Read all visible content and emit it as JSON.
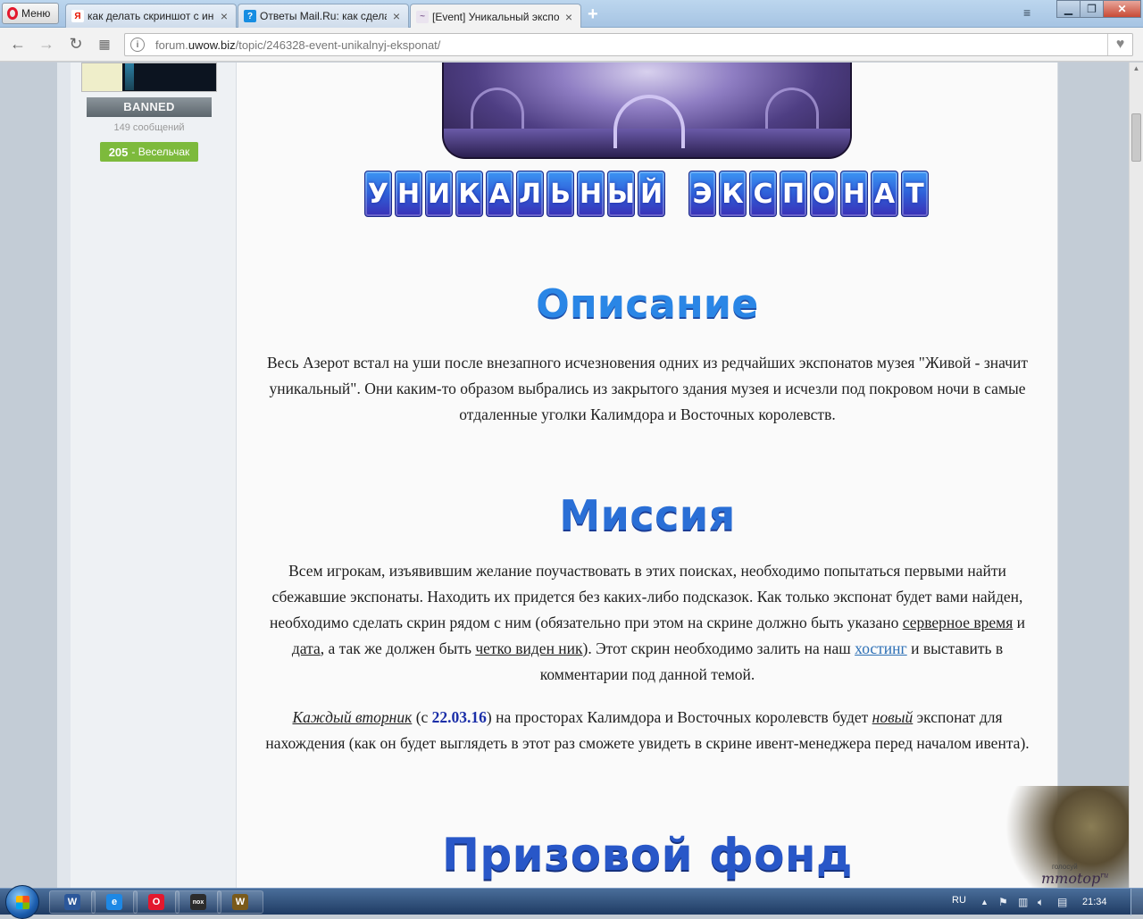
{
  "browser": {
    "menu_label": "Меню",
    "tabs": [
      {
        "title": "как делать скриншот с ин",
        "fav": "Я",
        "fav_color": "#e61400",
        "fav_bg": "#ffffff"
      },
      {
        "title": "Ответы Mail.Ru: как сдела",
        "fav": "?",
        "fav_color": "#ffffff",
        "fav_bg": "#168de2"
      },
      {
        "title": "[Event] Уникальный экспо",
        "fav": "~",
        "fav_color": "#8a6a9a",
        "fav_bg": "#eae4ef"
      }
    ],
    "url_domain": "forum.uwow.biz",
    "url_path": "/topic/246328-event-unikalnyj-eksponat/",
    "url_prefix": "forum."
  },
  "sidebar": {
    "banned_label": "BANNED",
    "posts_count": "149 сообщений",
    "rep_value": "205",
    "rep_label": "- Весельчак",
    "rep_color": "#7dba3c"
  },
  "post": {
    "banner_title": [
      "У",
      "Н",
      "И",
      "К",
      "А",
      "Л",
      "Ь",
      "Н",
      "Ы",
      "Й",
      " ",
      "Э",
      "К",
      "С",
      "П",
      "О",
      "Н",
      "А",
      "Т"
    ],
    "desc_heading": "Описание",
    "desc_text": "Весь Азерот встал на уши после внезапного исчезновения одних из редчайших экспонатов музея \"Живой - значит уникальный\". Они каким-то образом выбрались из закрытого здания музея и исчезли под покровом ночи в самые отдаленные уголки Калимдора и Восточных королевств.",
    "mission_heading": "Миссия",
    "mission": {
      "t1": "Всем игрокам, изъявившим желание поучаствовать в этих поисках, необходимо попытаться первыми найти сбежавшие экспонаты. Находить их придется без каких-либо подсказок. Как только экспонат будет вами найден, необходимо сделать скрин рядом с ним (обязательно при этом на скрине должно быть указано ",
      "u1": "серверное время",
      "t2": " и ",
      "u2": "дата",
      "t3": ", а так же должен быть ",
      "u3": "четко виден ник",
      "t4": "). Этот скрин необходимо залить на наш ",
      "link": "хостинг",
      "t5": " и выставить в комментарии под данной темой."
    },
    "weekly": {
      "u1": "Каждый вторник",
      "t1": " (с ",
      "date": "22.03.16",
      "t2": ") на просторах Калимдора и Восточных королевств будет ",
      "u2": "новый",
      "t3": " экспонат для нахождения (как он будет выглядеть в этот раз сможете увидеть в скрине ивент-менеджера перед началом ивента)."
    },
    "prize_heading": "Призовой фонд",
    "heading_color": "#2a86e6",
    "link_color": "#2c6fb5"
  },
  "watermark": {
    "small_text": "голосуй",
    "logo_text": "mmotop",
    "logo_mark": "ru"
  },
  "taskbar": {
    "apps": [
      {
        "name": "word-icon",
        "glyph": "W",
        "bg": "#2b579a"
      },
      {
        "name": "ie-icon",
        "glyph": "e",
        "bg": "#1e88e5"
      },
      {
        "name": "opera-icon",
        "glyph": "O",
        "bg": "#e3182d"
      },
      {
        "name": "nox-icon",
        "glyph": "nox",
        "bg": "#2c2c2c"
      },
      {
        "name": "wow-icon",
        "glyph": "W",
        "bg": "#7a5a1a"
      }
    ],
    "lang": "RU",
    "clock": "21:34"
  }
}
